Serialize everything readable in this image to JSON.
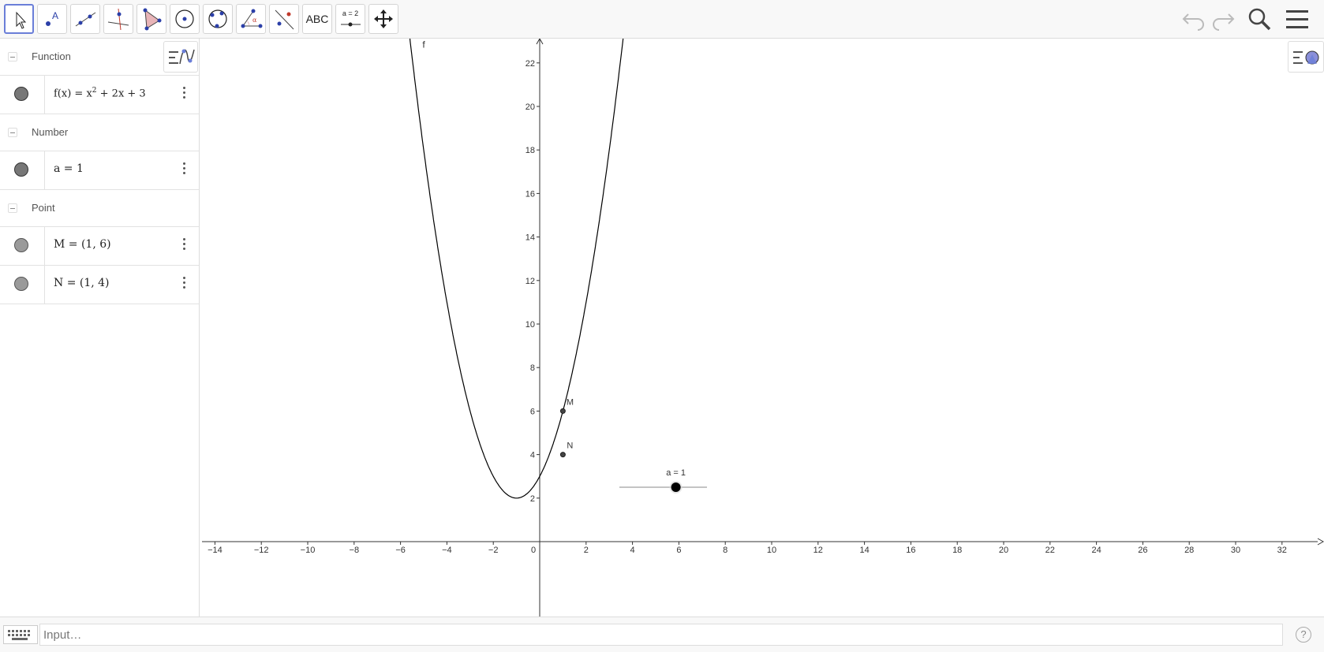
{
  "toolbar": {
    "tools": [
      "Move",
      "Point",
      "Line",
      "Perpendicular Line",
      "Polygon",
      "Circle with Center",
      "Circle through 3 Points",
      "Angle",
      "Reflect about Line",
      "Text",
      "Slider",
      "Move Graphics View"
    ],
    "text_tool_label": "ABC",
    "slider_tool_label": "a = 2"
  },
  "algebra": {
    "categories": [
      {
        "name": "Function"
      },
      {
        "name": "Number"
      },
      {
        "name": "Point"
      }
    ],
    "items": [
      {
        "expr_prefix": "f(x) = x",
        "expr_exp": "2",
        "expr_suffix": " + 2x + 3"
      },
      {
        "expr": "a = 1"
      },
      {
        "expr": "M = (1, 6)"
      },
      {
        "expr": "N = (1, 4)"
      }
    ]
  },
  "graphics": {
    "function_label": "f",
    "points": [
      {
        "name": "M",
        "x": 1,
        "y": 6
      },
      {
        "name": "N",
        "x": 1,
        "y": 4
      }
    ],
    "slider": {
      "label": "a = 1",
      "value": 1
    },
    "x_ticks": [
      "−14",
      "−12",
      "−10",
      "−8",
      "−6",
      "−4",
      "−2",
      "0",
      "2",
      "4",
      "6",
      "8",
      "10",
      "12",
      "14",
      "16",
      "18",
      "20",
      "22",
      "24",
      "26",
      "28",
      "30",
      "32"
    ],
    "y_ticks": [
      "2",
      "4",
      "6",
      "8",
      "10",
      "12",
      "14",
      "16",
      "18",
      "20",
      "22"
    ]
  },
  "input_bar": {
    "placeholder": "Input…",
    "help": "?"
  },
  "colors": {
    "accent": "#6a7ed8",
    "curve": "#000000",
    "point": "#444444"
  }
}
